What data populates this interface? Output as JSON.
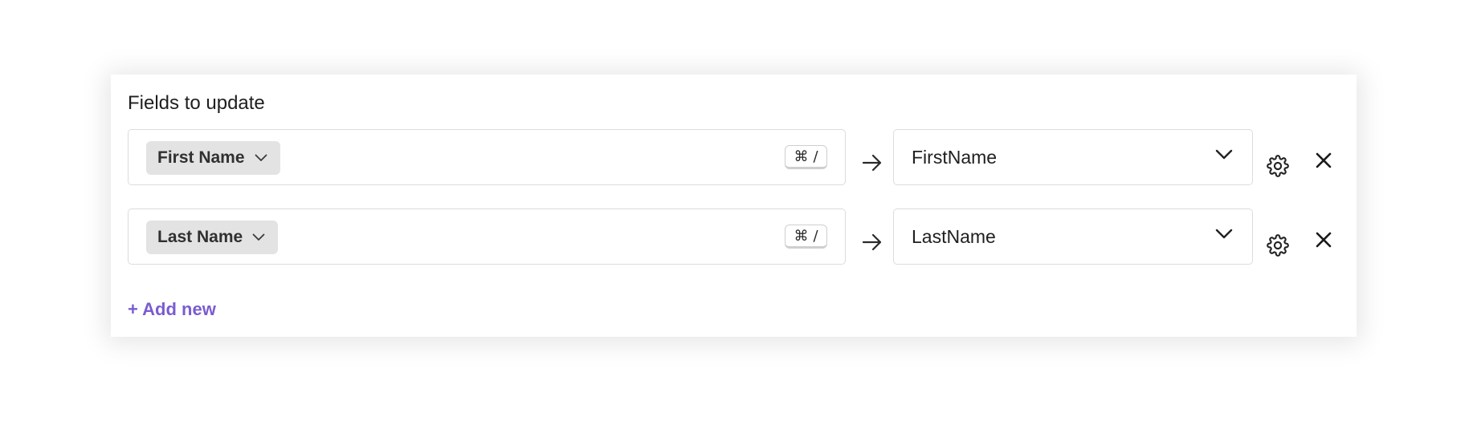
{
  "panel": {
    "title": "Fields to update"
  },
  "rows": [
    {
      "source_field": "First Name",
      "shortcut_symbol": "⌘",
      "shortcut_key": "/",
      "target_value": "FirstName"
    },
    {
      "source_field": "Last Name",
      "shortcut_symbol": "⌘",
      "shortcut_key": "/",
      "target_value": "LastName"
    }
  ],
  "actions": {
    "add_new_label": "+ Add new"
  },
  "icons": {
    "pill_chevron": "chevron-down-icon",
    "map_arrow": "arrow-right-icon",
    "select_chevron": "chevron-down-icon",
    "settings": "gear-icon",
    "remove": "close-icon"
  },
  "colors": {
    "accent": "#7a5cd1",
    "pill_background": "#e3e3e3",
    "border": "#dcdcdc"
  }
}
